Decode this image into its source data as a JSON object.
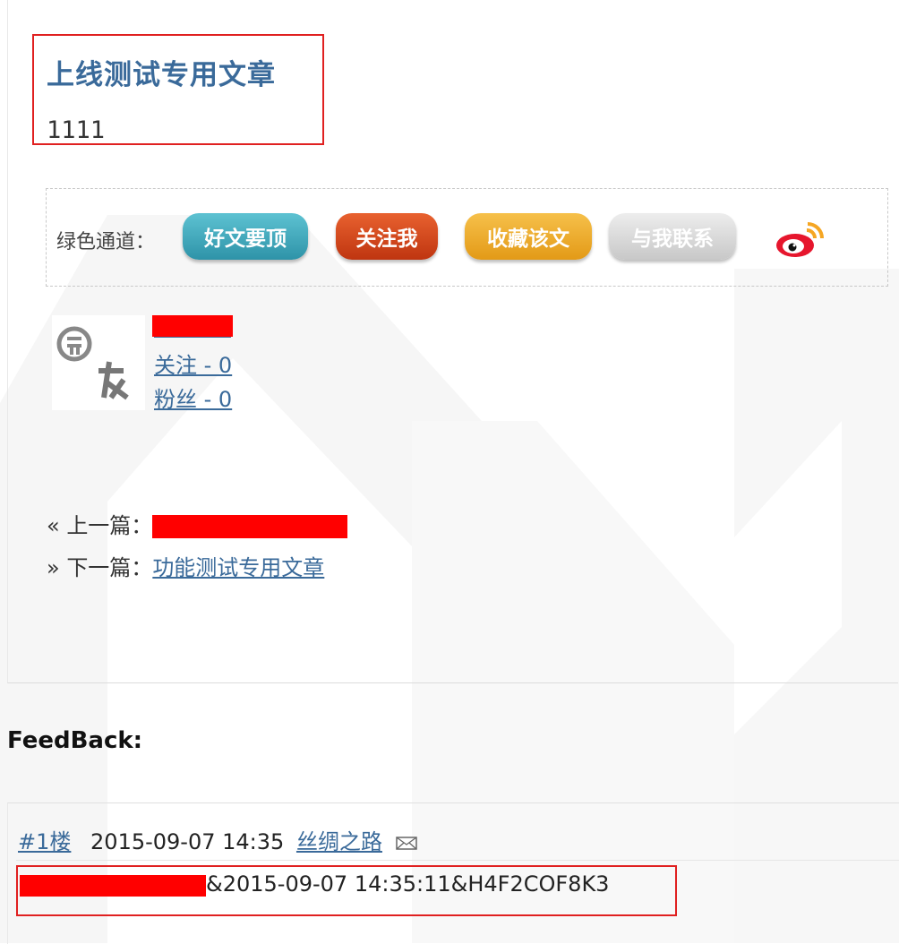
{
  "post": {
    "title": "上线测试专用文章",
    "body": "1111"
  },
  "green_channel": {
    "label": "绿色通道：",
    "buttons": [
      {
        "label": "好文要顶",
        "color": "#3aa3b6"
      },
      {
        "label": "关注我",
        "color": "#d2401e"
      },
      {
        "label": "收藏该文",
        "color": "#eba326"
      },
      {
        "label": "与我联系",
        "color": "#d4d4d4"
      }
    ],
    "share_icon": "weibo-icon"
  },
  "author": {
    "avatar_icon": "avatar-icon",
    "follow": "关注 - 0",
    "fans": "粉丝 - 0"
  },
  "navigation": {
    "prev_prefix": "« 上一篇：",
    "next_prefix": "» 下一篇：",
    "next_title": "功能测试专用文章"
  },
  "feedback": {
    "heading": "FeedBack:",
    "comments": [
      {
        "floor": "#1楼",
        "date": "2015-09-07 14:35",
        "author": "丝绸之路",
        "mail_icon": "mail-icon",
        "content": "&2015-09-07 14:35:11&H4F2COF8K3"
      }
    ]
  },
  "colors": {
    "title": "#3a6a9a",
    "link": "#3a6a9a",
    "highlight_border": "#e02020",
    "redaction": "#ff0000"
  }
}
